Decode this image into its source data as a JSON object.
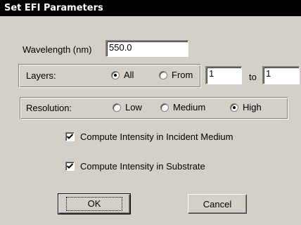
{
  "window": {
    "title": "Set EFI Parameters"
  },
  "wavelength": {
    "label": "Wavelength (nm)",
    "value": "550.0"
  },
  "layers": {
    "label": "Layers:",
    "all_label": "All",
    "from_label": "From",
    "to_label": "to",
    "from_value": "1",
    "to_value": "1",
    "selected": "All"
  },
  "resolution": {
    "label": "Resolution:",
    "low_label": "Low",
    "medium_label": "Medium",
    "high_label": "High",
    "selected": "High"
  },
  "options": {
    "incident_label": "Compute Intensity in Incident Medium",
    "incident_checked": true,
    "substrate_label": "Compute Intensity in Substrate",
    "substrate_checked": true
  },
  "buttons": {
    "ok_label": "OK",
    "cancel_label": "Cancel"
  }
}
